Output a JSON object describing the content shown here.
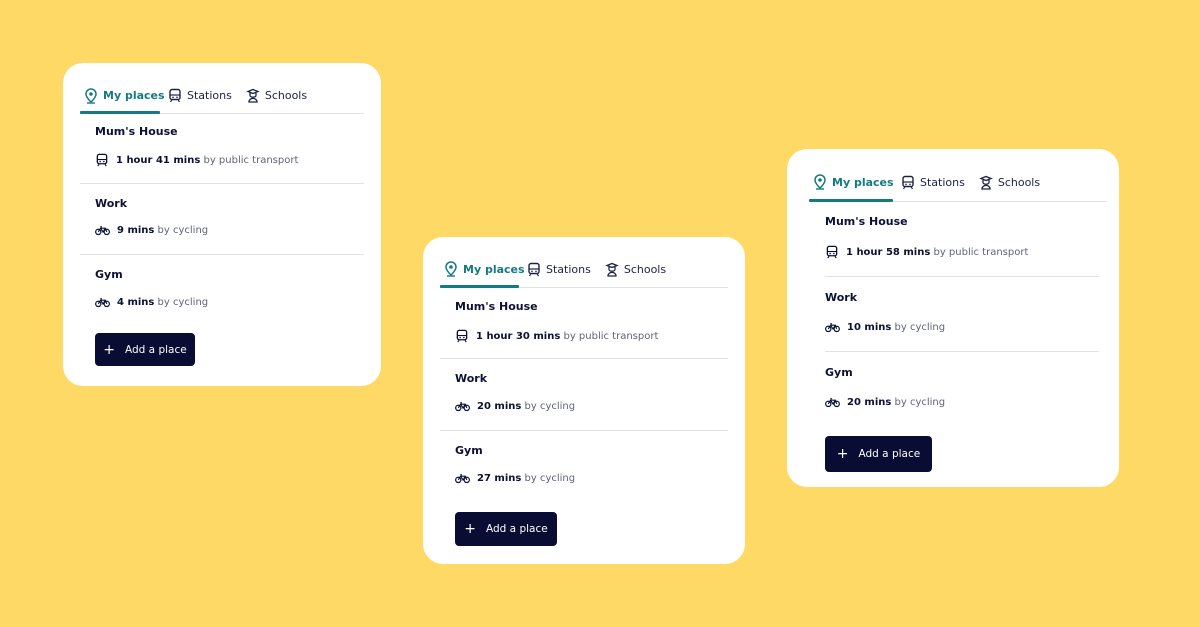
{
  "tabs": [
    {
      "label": "My places",
      "icon": "pin-icon",
      "active": true
    },
    {
      "label": "Stations",
      "icon": "train-icon"
    },
    {
      "label": "Schools",
      "icon": "school-icon"
    }
  ],
  "add_button": {
    "label": "Add a place",
    "icon": "plus-icon"
  },
  "colors": {
    "accent": "#137a84",
    "background": "#FFD966",
    "button": "#0a0d33"
  },
  "cards": [
    {
      "places": [
        {
          "name": "Mum's House",
          "duration": "1 hour 41 mins",
          "mode": "by public transport",
          "icon": "train-icon"
        },
        {
          "name": "Work",
          "duration": "9 mins",
          "mode": "by cycling",
          "icon": "bicycle-icon"
        },
        {
          "name": "Gym",
          "duration": "4 mins",
          "mode": "by cycling",
          "icon": "bicycle-icon"
        }
      ]
    },
    {
      "places": [
        {
          "name": "Mum's House",
          "duration": "1 hour 30 mins",
          "mode": "by public transport",
          "icon": "train-icon"
        },
        {
          "name": "Work",
          "duration": "20 mins",
          "mode": "by cycling",
          "icon": "bicycle-icon"
        },
        {
          "name": "Gym",
          "duration": "27 mins",
          "mode": "by cycling",
          "icon": "bicycle-icon"
        }
      ]
    },
    {
      "places": [
        {
          "name": "Mum's House",
          "duration": "1 hour 58 mins",
          "mode": "by public transport",
          "icon": "train-icon"
        },
        {
          "name": "Work",
          "duration": "10 mins",
          "mode": "by cycling",
          "icon": "bicycle-icon"
        },
        {
          "name": "Gym",
          "duration": "20 mins",
          "mode": "by cycling",
          "icon": "bicycle-icon"
        }
      ]
    }
  ]
}
